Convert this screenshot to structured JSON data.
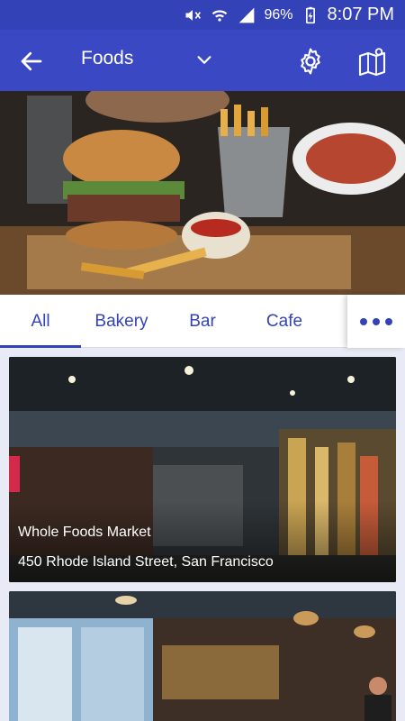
{
  "status_bar": {
    "battery_percent": "96%",
    "time": "8:07 PM",
    "icons": [
      "mute-icon",
      "wifi-icon",
      "signal-icon",
      "battery-icon"
    ]
  },
  "toolbar": {
    "title": "Foods",
    "back_icon": "back-arrow-icon",
    "dropdown_icon": "chevron-down-icon",
    "settings_icon": "gear-icon",
    "map_icon": "map-icon",
    "background": "#3a48c4",
    "status_background": "#3442b8"
  },
  "hero": {
    "image": "burger-and-fries-photo"
  },
  "tabs": {
    "items": [
      {
        "label": "All",
        "selected": true
      },
      {
        "label": "Bakery",
        "selected": false
      },
      {
        "label": "Bar",
        "selected": false
      },
      {
        "label": "Cafe",
        "selected": false
      }
    ],
    "more_icon": "more-horizontal-icon",
    "accent": "#3442b8"
  },
  "places": [
    {
      "name": "Whole Foods Market",
      "address": "450 Rhode Island Street, San Francisco",
      "image": "grocery-store-interior-photo"
    },
    {
      "name": "",
      "address": "",
      "image": "cafe-interior-photo"
    }
  ]
}
